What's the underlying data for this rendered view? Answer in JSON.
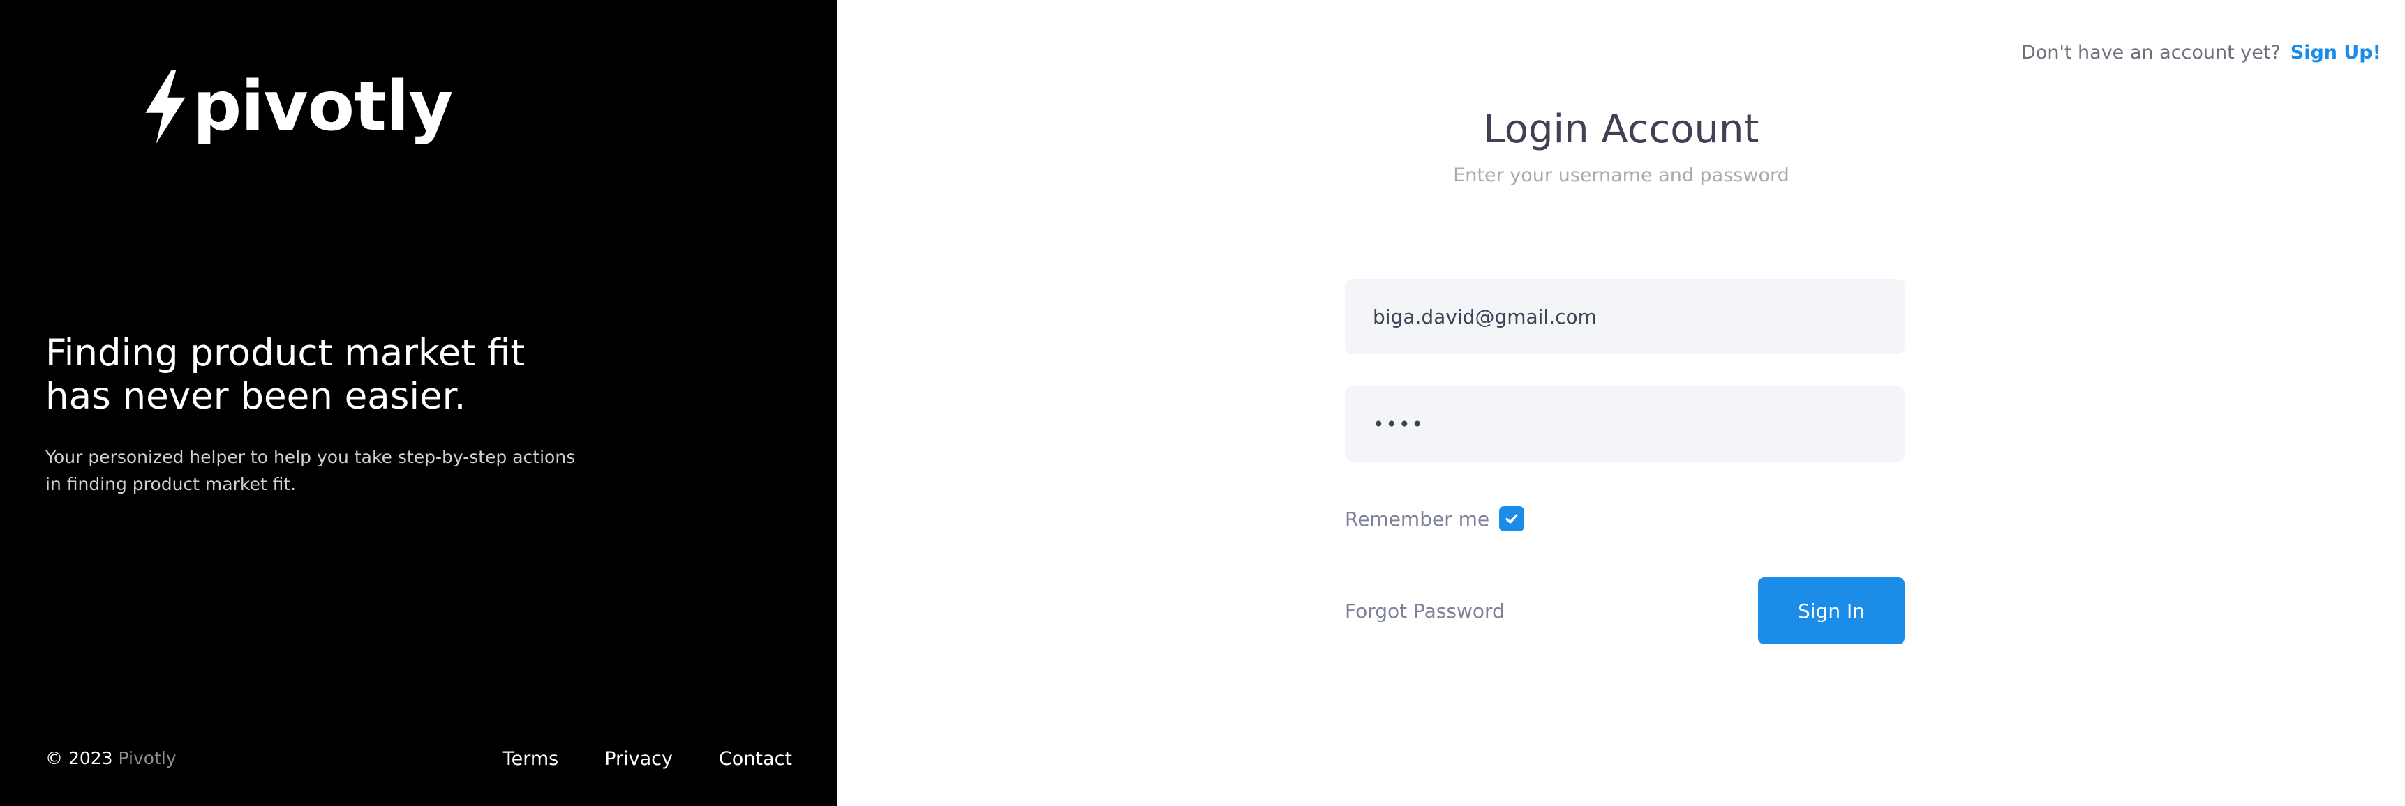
{
  "aside": {
    "brand_name": "pivotly",
    "headline_lines": [
      "Finding product market fit",
      "has never been easier."
    ],
    "subtext_lines": [
      "Your personized helper to help you take step-by-step actions",
      "in finding product market fit."
    ],
    "copyright_prefix": "© 2023",
    "copyright_brand": "Pivotly",
    "footer_links": [
      "Terms",
      "Privacy",
      "Contact"
    ]
  },
  "header": {
    "signup_prompt": "Don't have an account yet?",
    "signup_link": "Sign Up!"
  },
  "login": {
    "title": "Login Account",
    "subtitle": "Enter your username and password",
    "email_value": "biga.david@gmail.com",
    "password_value": "••••",
    "remember_label": "Remember me",
    "remember_checked": true,
    "forgot_label": "Forgot Password",
    "submit_label": "Sign In"
  },
  "colors": {
    "accent": "#1B8CE8",
    "aside_bg": "#000000",
    "field_bg": "#F4F5F9",
    "title": "#3F4254",
    "muted": "#7E8299"
  },
  "icons": {
    "logo": "lightning-bolt-icon",
    "checkbox": "check-icon"
  }
}
